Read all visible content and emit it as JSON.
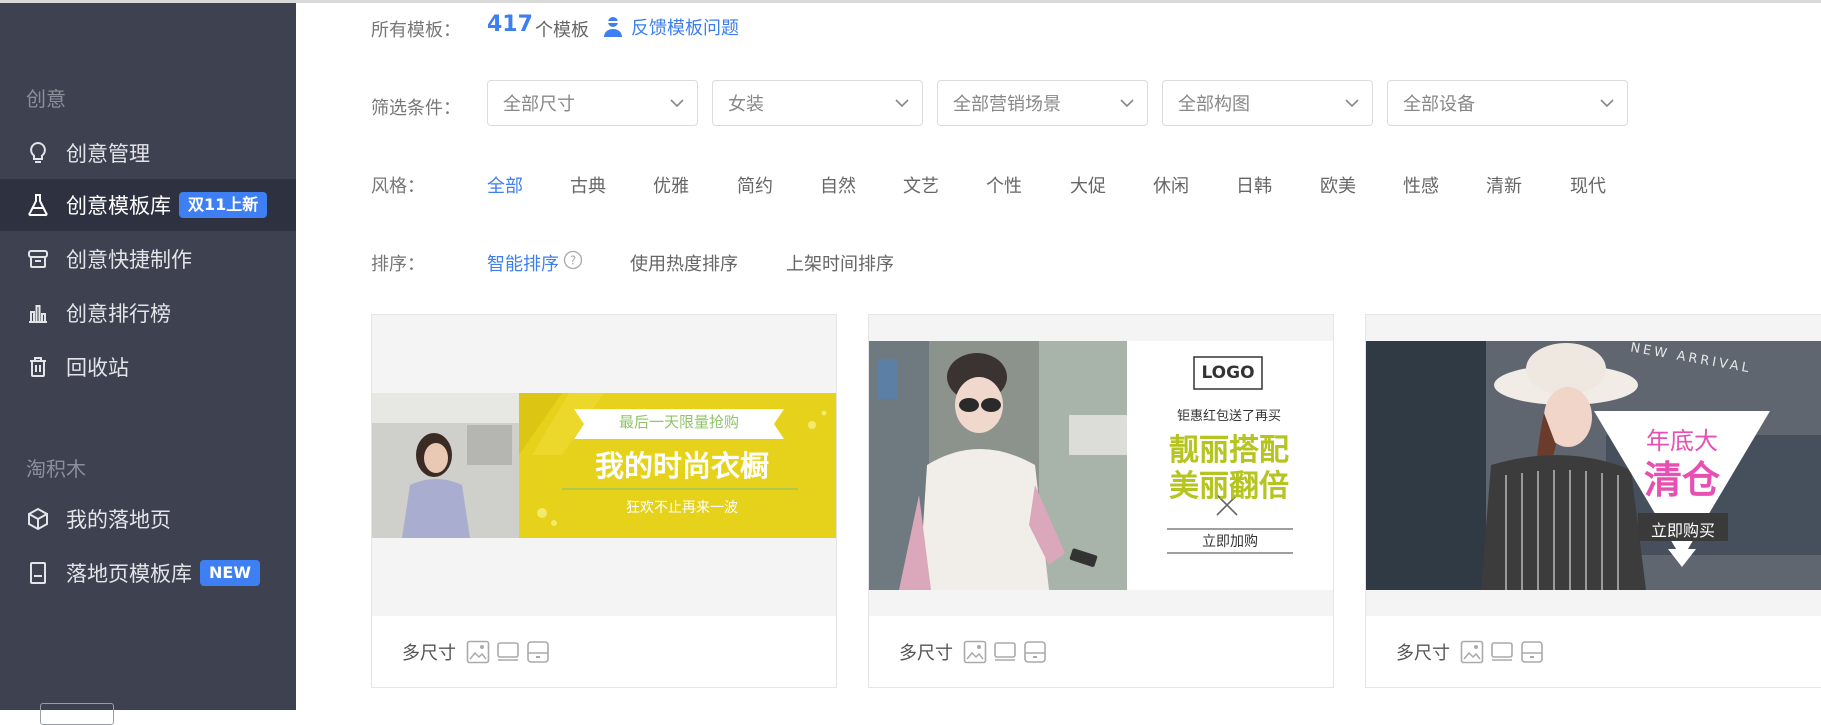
{
  "sidebar": {
    "section1_title": "创意",
    "section2_title": "淘积木",
    "items": [
      {
        "label": "创意管理",
        "icon": "lightbulb-icon"
      },
      {
        "label": "创意模板库",
        "icon": "flask-icon",
        "badge": "双11上新"
      },
      {
        "label": "创意快捷制作",
        "icon": "quick-make-icon"
      },
      {
        "label": "创意排行榜",
        "icon": "bar-chart-icon"
      },
      {
        "label": "回收站",
        "icon": "trash-icon"
      },
      {
        "label": "我的落地页",
        "icon": "cube-icon"
      },
      {
        "label": "落地页模板库",
        "icon": "page-template-icon",
        "badge": "NEW"
      }
    ]
  },
  "summary": {
    "label": "所有模板：",
    "count": "417",
    "unit": "个模板",
    "feedback": "反馈模板问题"
  },
  "filters": {
    "label": "筛选条件：",
    "selects": [
      "全部尺寸",
      "女装",
      "全部营销场景",
      "全部构图",
      "全部设备"
    ]
  },
  "style": {
    "label": "风格：",
    "options": [
      "全部",
      "古典",
      "优雅",
      "简约",
      "自然",
      "文艺",
      "个性",
      "大促",
      "休闲",
      "日韩",
      "欧美",
      "性感",
      "清新",
      "现代"
    ],
    "selected": "全部"
  },
  "sort": {
    "label": "排序：",
    "options": [
      "智能排序",
      "使用热度排序",
      "上架时间排序"
    ],
    "selected": "智能排序"
  },
  "cards": [
    {
      "footer": "多尺寸",
      "banner": {
        "ribbon": "最后一天限量抢购",
        "title": "我的时尚衣橱",
        "sub": "狂欢不止再来一波"
      }
    },
    {
      "footer": "多尺寸",
      "banner": {
        "logo": "LOGO",
        "line1": "钜惠红包送了再买",
        "line2": "靓丽搭配",
        "line3": "美丽翻倍",
        "button": "立即加购"
      }
    },
    {
      "footer": "多尺寸",
      "banner": {
        "arc": "NEW ARRIVAL",
        "line1": "年底大",
        "line2": "清仓",
        "button": "立即购买"
      }
    }
  ],
  "colors": {
    "accent": "#3d7ef0",
    "sidebar_bg": "#3d4150",
    "banner_yellow": "#e6d21a",
    "banner_green": "#b5c41f",
    "banner_pink": "#e84fb3"
  }
}
